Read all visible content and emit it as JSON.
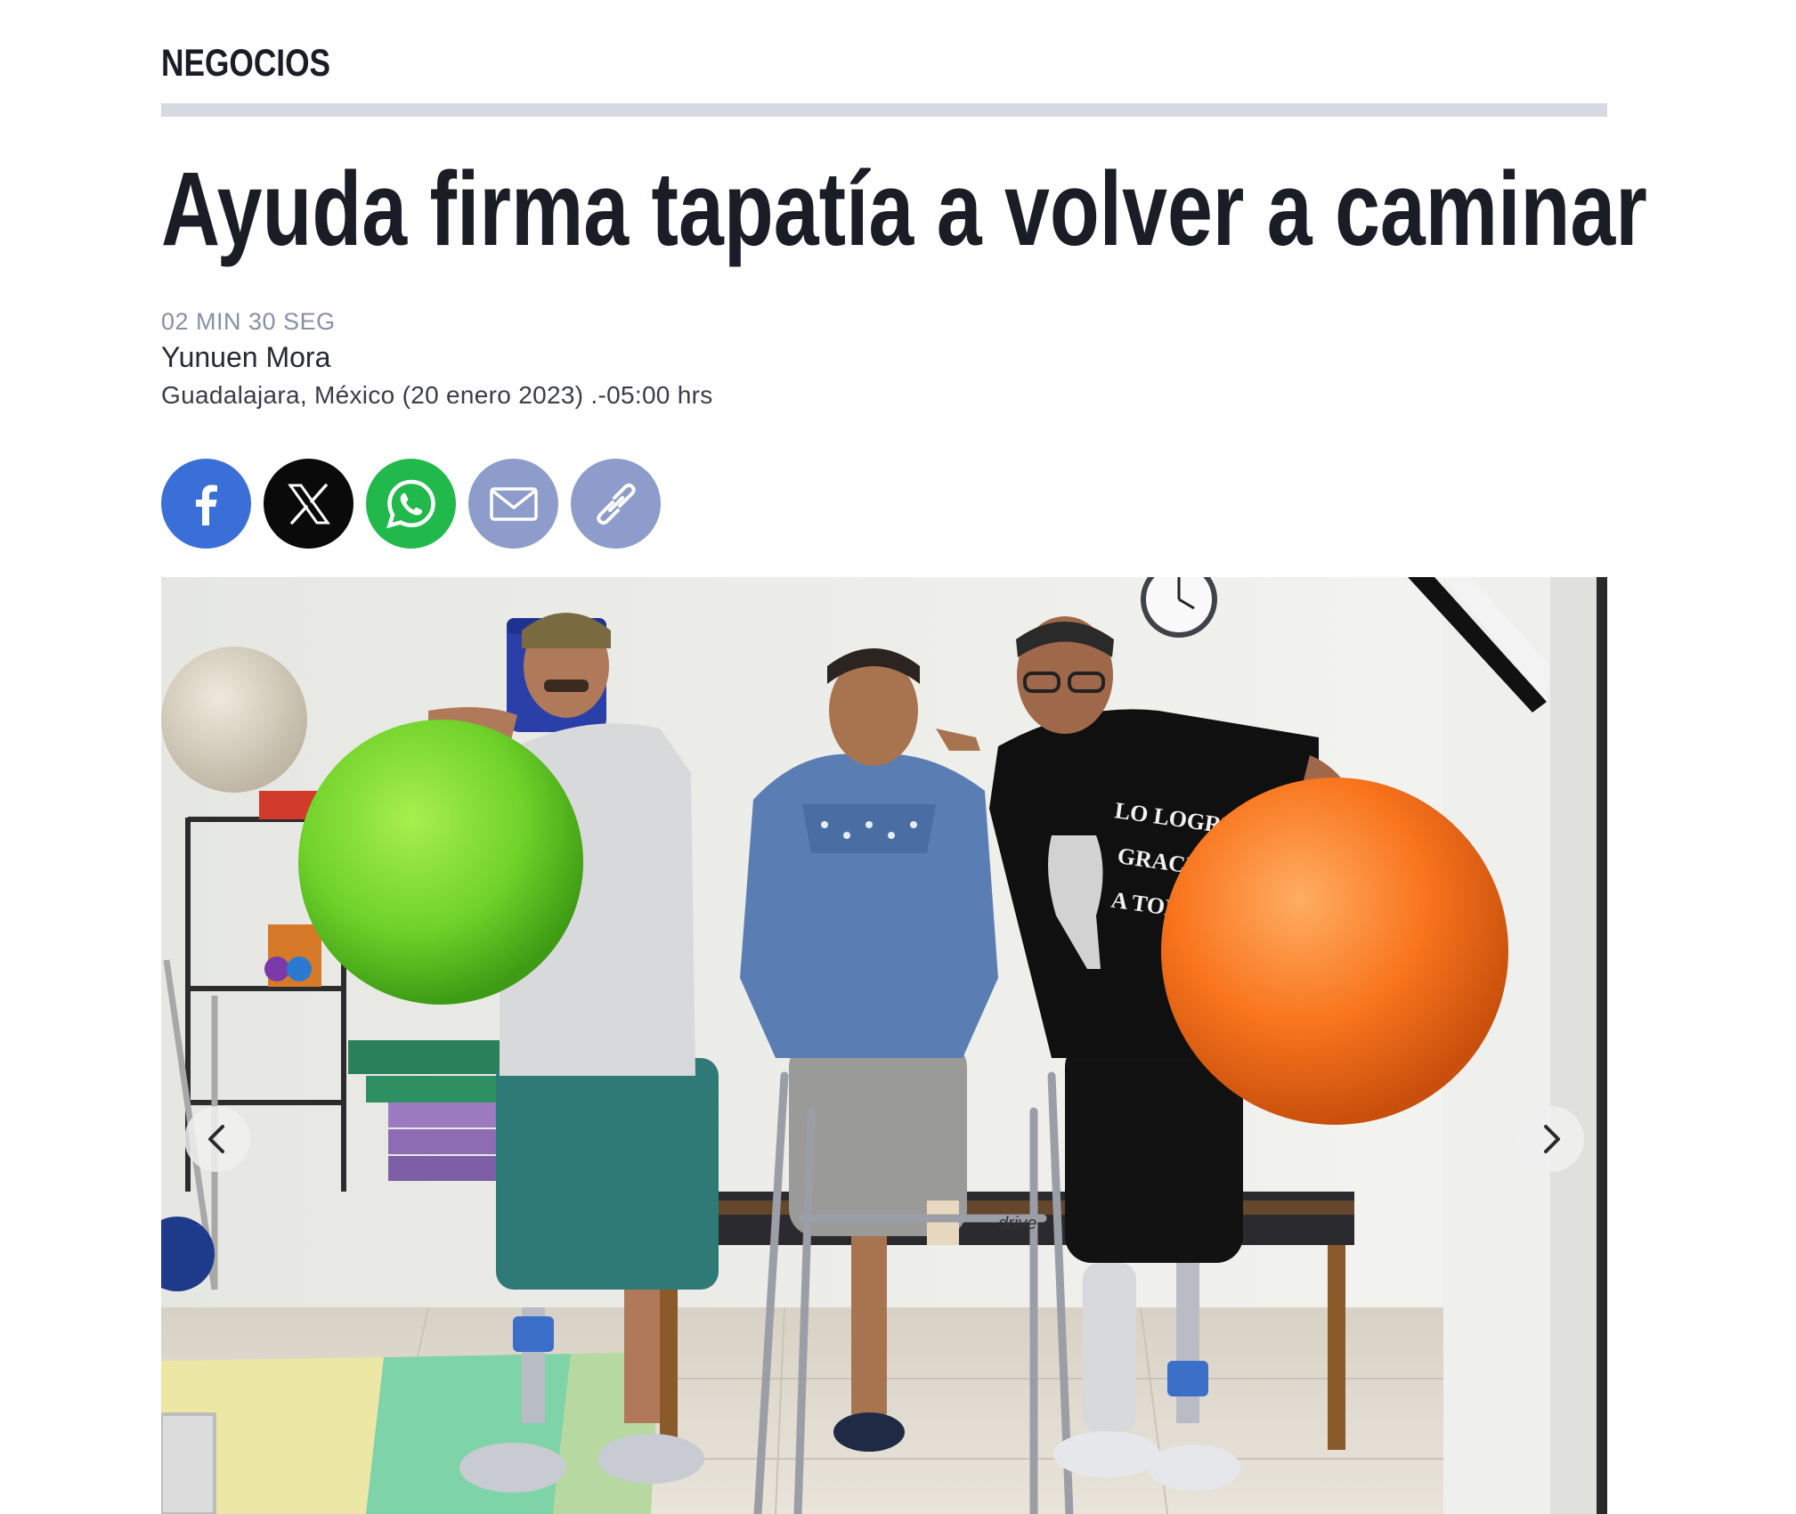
{
  "section": {
    "label": "NEGOCIOS"
  },
  "article": {
    "headline": "Ayuda firma tapatía a volver a caminar",
    "read_time": "02 MIN 30 SEG",
    "author": "Yunuen Mora",
    "dateline": "Guadalajara, México (20 enero 2023) .-05:00 hrs"
  },
  "share": {
    "buttons": [
      {
        "icon": "facebook-icon",
        "color": "#3b6fd8"
      },
      {
        "icon": "x-icon",
        "color": "#0a0a0a"
      },
      {
        "icon": "whatsapp-icon",
        "color": "#22b94c"
      },
      {
        "icon": "email-icon",
        "color": "#8e9ccb"
      },
      {
        "icon": "link-icon",
        "color": "#8e9ccb"
      }
    ]
  },
  "gallery": {
    "shirt_text": [
      "LO LOGRÉ!",
      "GRACIAS",
      "A TODOS!!"
    ],
    "walker_brand": "drive",
    "prev_icon": "chevron-left-icon",
    "next_icon": "chevron-right-icon"
  }
}
